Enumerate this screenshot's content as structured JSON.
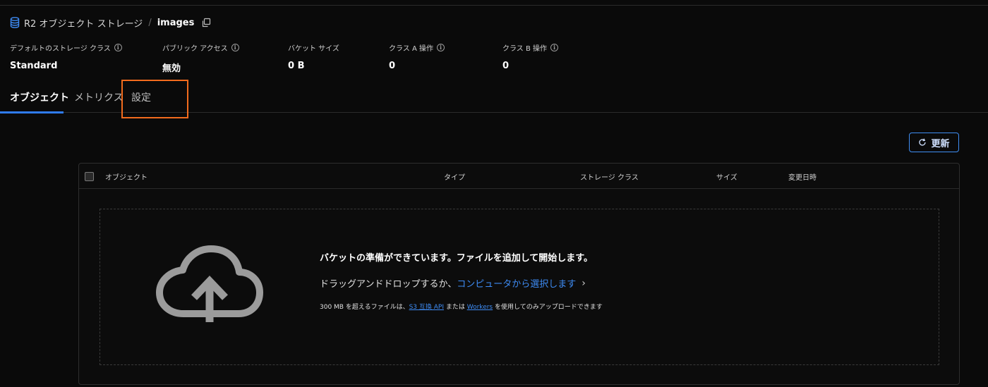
{
  "breadcrumb": {
    "parent": "R2 オブジェクト ストレージ",
    "separator": "/",
    "current": "images"
  },
  "stats": [
    {
      "label": "デフォルトのストレージ クラス",
      "value": "Standard"
    },
    {
      "label": "パブリック アクセス",
      "value": "無効"
    },
    {
      "label": "バケット サイズ",
      "value": "0 B"
    },
    {
      "label": "クラス A 操作",
      "value": "0"
    },
    {
      "label": "クラス B 操作",
      "value": "0"
    }
  ],
  "tabs": [
    {
      "label": "オブジェクト",
      "active": true
    },
    {
      "label": "メトリクス",
      "active": false
    },
    {
      "label": "設定",
      "active": false
    }
  ],
  "toolbar": {
    "refresh_label": "更新"
  },
  "table": {
    "columns": [
      "オブジェクト",
      "タイプ",
      "ストレージ クラス",
      "サイズ",
      "変更日時"
    ]
  },
  "dropzone": {
    "title": "バケットの準備ができています。ファイルを追加して開始します。",
    "drag_text": "ドラッグアンドドロップするか、",
    "select_link": "コンピュータから選択します",
    "note_prefix": "300 MB を超えるファイルは、",
    "note_link1": "S3 互換 API",
    "note_mid": " または ",
    "note_link2": "Workers",
    "note_suffix": " を使用してのみアップロードできます"
  },
  "colors": {
    "accent": "#2f7bf2",
    "link": "#3e8cf5",
    "highlight": "#f26b1d",
    "background": "#0a0a0a"
  },
  "icons": [
    "database-icon",
    "copy-icon",
    "info-icon",
    "refresh-icon",
    "cloud-upload-icon",
    "chevron-right-icon"
  ]
}
